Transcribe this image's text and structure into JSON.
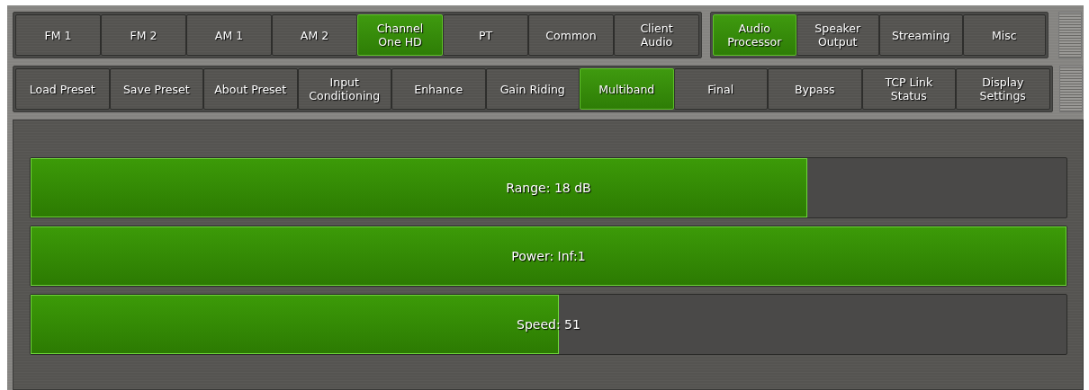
{
  "top_tabs": [
    {
      "label": "FM 1",
      "selected": false
    },
    {
      "label": "FM 2",
      "selected": false
    },
    {
      "label": "AM 1",
      "selected": false
    },
    {
      "label": "AM 2",
      "selected": false
    },
    {
      "label": "Channel\nOne HD",
      "selected": true
    },
    {
      "label": "PT",
      "selected": false
    },
    {
      "label": "Common",
      "selected": false
    },
    {
      "label": "Client\nAudio",
      "selected": false
    }
  ],
  "section_tabs": [
    {
      "label": "Audio\nProcessor",
      "selected": true
    },
    {
      "label": "Speaker\nOutput",
      "selected": false
    },
    {
      "label": "Streaming",
      "selected": false
    },
    {
      "label": "Misc",
      "selected": false
    }
  ],
  "sub_tabs": [
    {
      "label": "Load Preset",
      "selected": false
    },
    {
      "label": "Save Preset",
      "selected": false
    },
    {
      "label": "About Preset",
      "selected": false
    },
    {
      "label": "Input\nConditioning",
      "selected": false
    },
    {
      "label": "Enhance",
      "selected": false
    },
    {
      "label": "Gain Riding",
      "selected": false
    },
    {
      "label": "Multiband",
      "selected": true
    },
    {
      "label": "Final",
      "selected": false
    },
    {
      "label": "Bypass",
      "selected": false
    },
    {
      "label": "TCP Link\nStatus",
      "selected": false
    },
    {
      "label": "Display\nSettings",
      "selected": false
    }
  ],
  "sliders": [
    {
      "label": "Range: 18 dB",
      "level": 0.75
    },
    {
      "label": "Power: Inf:1",
      "level": 1.0
    },
    {
      "label": "Speed: 51",
      "level": 0.51
    }
  ]
}
